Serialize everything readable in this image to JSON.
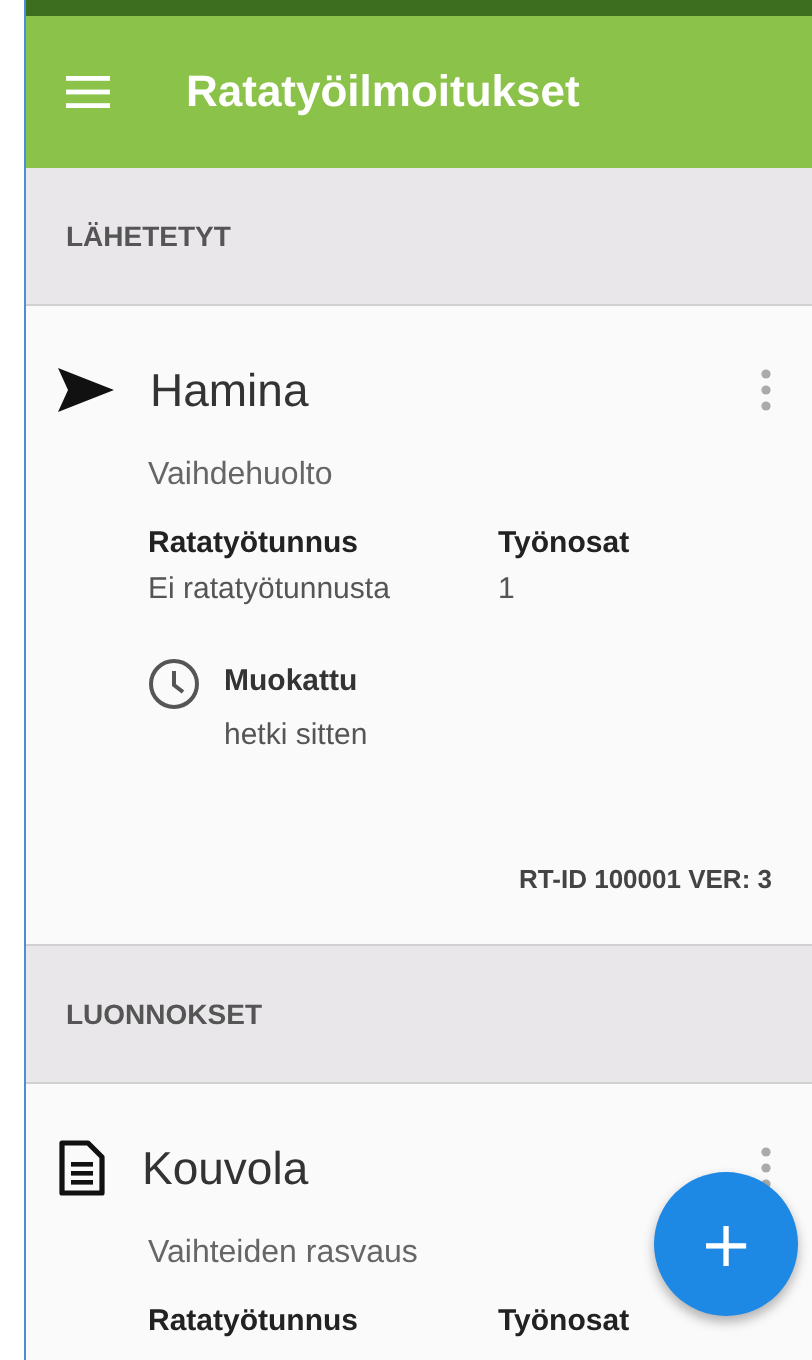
{
  "app_bar": {
    "title": "Ratatyöilmoitukset"
  },
  "sections": [
    {
      "title": "LÄHETETYT",
      "cards": [
        {
          "kind": "sent",
          "title": "Hamina",
          "subtitle": "Vaihdehuolto",
          "fields": [
            {
              "label": "Ratatyötunnus",
              "value": "Ei ratatyötunnusta"
            },
            {
              "label": "Työnosat",
              "value": "1"
            }
          ],
          "modified": {
            "label": "Muokattu",
            "time": "hetki sitten"
          },
          "footer": "RT-ID 100001 VER: 3"
        }
      ]
    },
    {
      "title": "LUONNOKSET",
      "cards": [
        {
          "kind": "draft",
          "title": "Kouvola",
          "subtitle": "Vaihteiden rasvaus",
          "fields": [
            {
              "label": "Ratatyötunnus"
            },
            {
              "label": "Työnosat"
            }
          ]
        }
      ]
    }
  ],
  "fab": {
    "label": "+"
  }
}
